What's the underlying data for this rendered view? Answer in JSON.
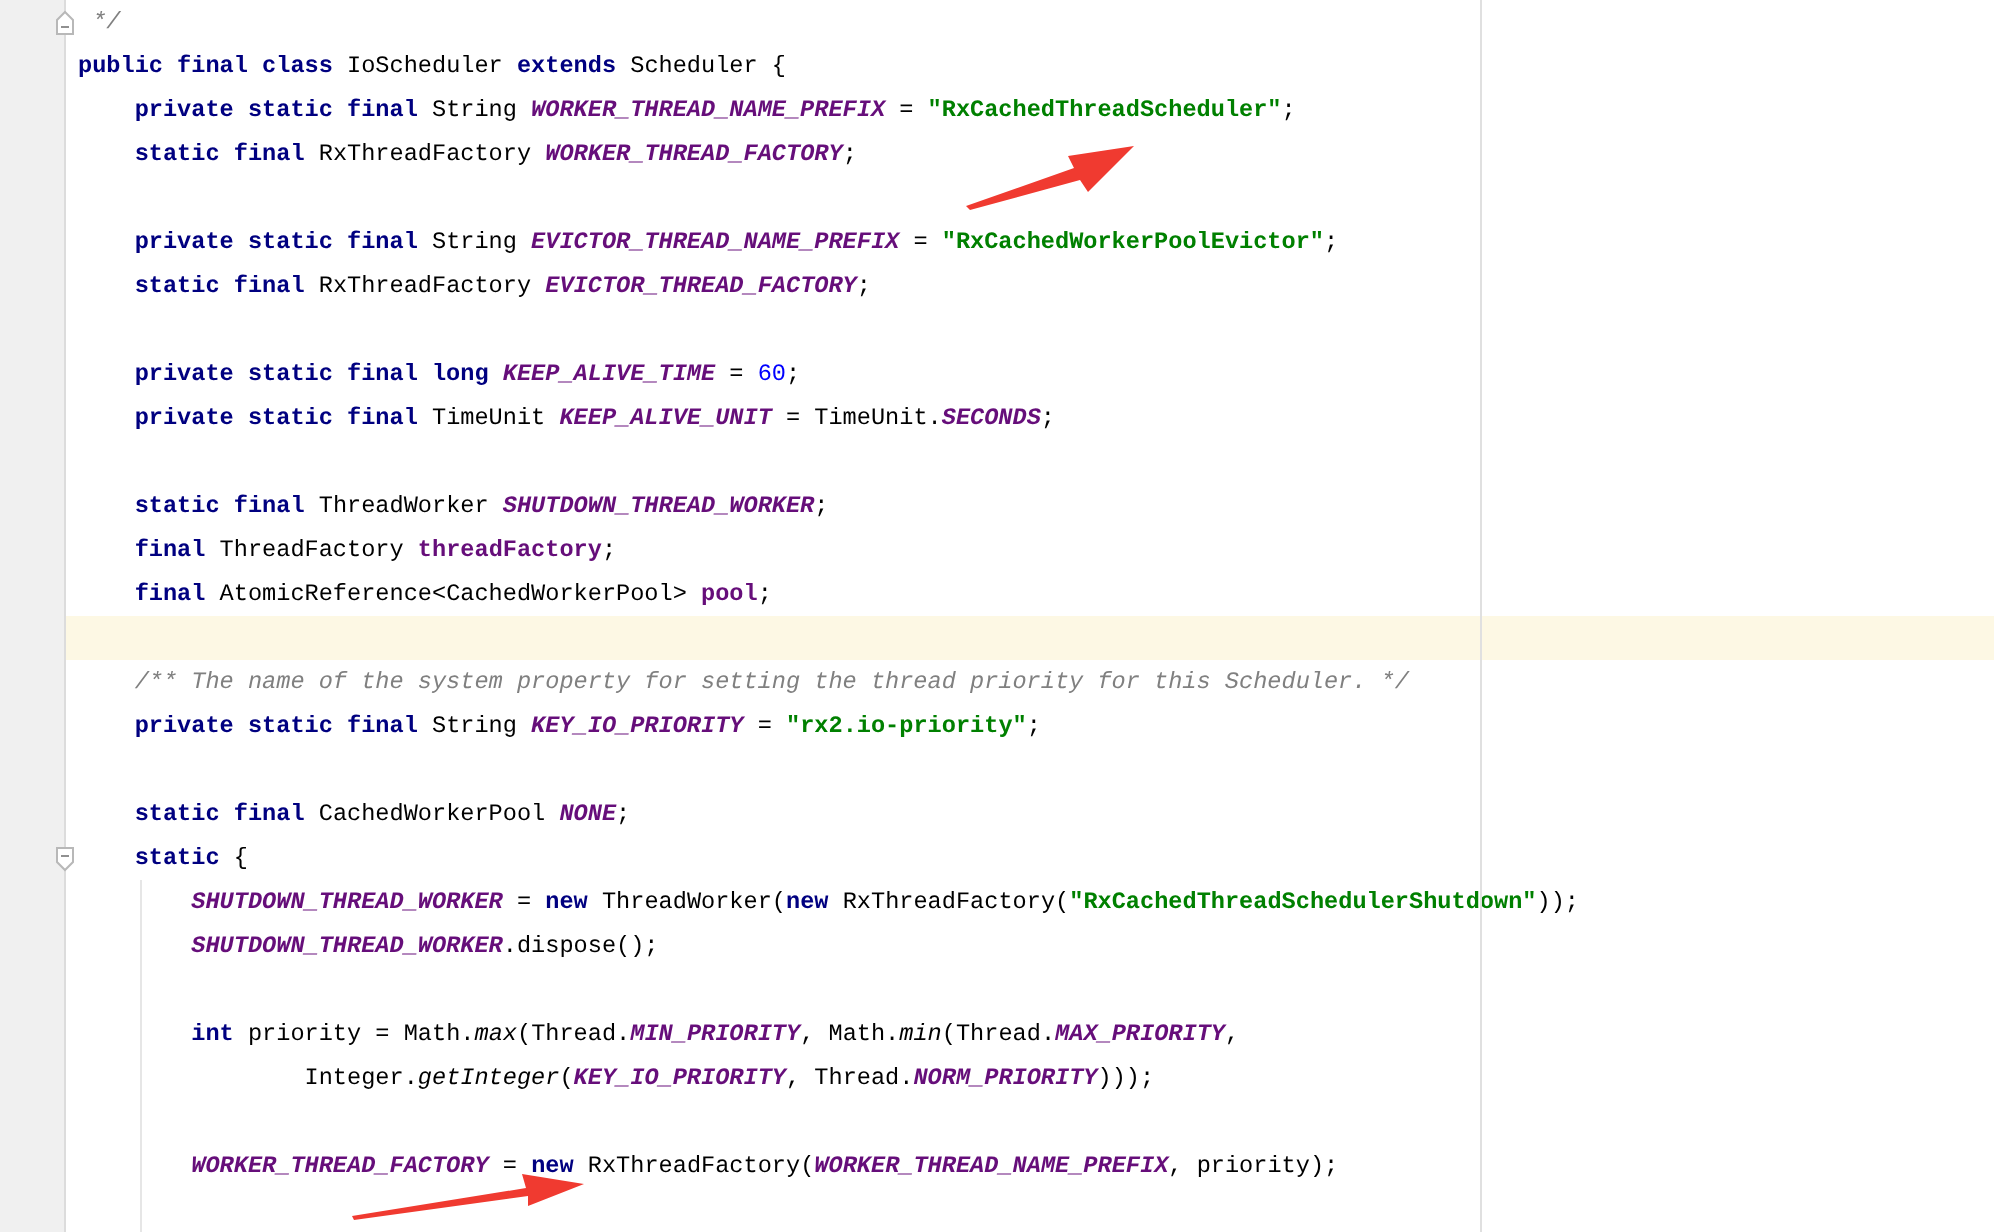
{
  "editor": {
    "lines": [
      {
        "current": false,
        "fold_end": true,
        "tokens": [
          {
            "kind": "comment",
            "text": " */"
          }
        ]
      },
      {
        "current": false,
        "tokens": [
          {
            "kind": "keyword",
            "text": "public final class "
          },
          {
            "kind": "plain",
            "text": "IoScheduler "
          },
          {
            "kind": "keyword",
            "text": "extends "
          },
          {
            "kind": "plain",
            "text": "Scheduler {"
          }
        ]
      },
      {
        "current": false,
        "tokens": [
          {
            "kind": "keyword",
            "text": "    private static final "
          },
          {
            "kind": "plain",
            "text": "String "
          },
          {
            "kind": "constant",
            "text": "WORKER_THREAD_NAME_PREFIX"
          },
          {
            "kind": "plain",
            "text": " = "
          },
          {
            "kind": "string",
            "text": "\"RxCachedThreadScheduler\""
          },
          {
            "kind": "plain",
            "text": ";"
          }
        ]
      },
      {
        "current": false,
        "tokens": [
          {
            "kind": "keyword",
            "text": "    static final "
          },
          {
            "kind": "plain",
            "text": "RxThreadFactory "
          },
          {
            "kind": "constant",
            "text": "WORKER_THREAD_FACTORY"
          },
          {
            "kind": "plain",
            "text": ";"
          }
        ]
      },
      {
        "current": false
      },
      {
        "current": false,
        "tokens": [
          {
            "kind": "keyword",
            "text": "    private static final "
          },
          {
            "kind": "plain",
            "text": "String "
          },
          {
            "kind": "constant",
            "text": "EVICTOR_THREAD_NAME_PREFIX"
          },
          {
            "kind": "plain",
            "text": " = "
          },
          {
            "kind": "string",
            "text": "\"RxCachedWorkerPoolEvictor\""
          },
          {
            "kind": "plain",
            "text": ";"
          }
        ]
      },
      {
        "current": false,
        "tokens": [
          {
            "kind": "keyword",
            "text": "    static final "
          },
          {
            "kind": "plain",
            "text": "RxThreadFactory "
          },
          {
            "kind": "constant",
            "text": "EVICTOR_THREAD_FACTORY"
          },
          {
            "kind": "plain",
            "text": ";"
          }
        ]
      },
      {
        "current": false
      },
      {
        "current": false,
        "tokens": [
          {
            "kind": "keyword",
            "text": "    private static final long "
          },
          {
            "kind": "constant",
            "text": "KEEP_ALIVE_TIME"
          },
          {
            "kind": "plain",
            "text": " = "
          },
          {
            "kind": "number",
            "text": "60"
          },
          {
            "kind": "plain",
            "text": ";"
          }
        ]
      },
      {
        "current": false,
        "tokens": [
          {
            "kind": "keyword",
            "text": "    private static final "
          },
          {
            "kind": "plain",
            "text": "TimeUnit "
          },
          {
            "kind": "constant",
            "text": "KEEP_ALIVE_UNIT"
          },
          {
            "kind": "plain",
            "text": " = TimeUnit."
          },
          {
            "kind": "constant",
            "text": "SECONDS"
          },
          {
            "kind": "plain",
            "text": ";"
          }
        ]
      },
      {
        "current": false
      },
      {
        "current": false,
        "tokens": [
          {
            "kind": "keyword",
            "text": "    static final "
          },
          {
            "kind": "plain",
            "text": "ThreadWorker "
          },
          {
            "kind": "constant",
            "text": "SHUTDOWN_THREAD_WORKER"
          },
          {
            "kind": "plain",
            "text": ";"
          }
        ]
      },
      {
        "current": false,
        "tokens": [
          {
            "kind": "keyword",
            "text": "    final "
          },
          {
            "kind": "plain",
            "text": "ThreadFactory "
          },
          {
            "kind": "field",
            "text": "threadFactory"
          },
          {
            "kind": "plain",
            "text": ";"
          }
        ]
      },
      {
        "current": false,
        "tokens": [
          {
            "kind": "keyword",
            "text": "    final "
          },
          {
            "kind": "plain",
            "text": "AtomicReference<CachedWorkerPool> "
          },
          {
            "kind": "field",
            "text": "pool"
          },
          {
            "kind": "plain",
            "text": ";"
          }
        ]
      },
      {
        "current": true
      },
      {
        "current": false,
        "tokens": [
          {
            "kind": "comment",
            "text": "    /** The name of the system property for setting the thread priority for this Scheduler. */"
          }
        ]
      },
      {
        "current": false,
        "tokens": [
          {
            "kind": "keyword",
            "text": "    private static final "
          },
          {
            "kind": "plain",
            "text": "String "
          },
          {
            "kind": "constant",
            "text": "KEY_IO_PRIORITY"
          },
          {
            "kind": "plain",
            "text": " = "
          },
          {
            "kind": "string",
            "text": "\"rx2.io-priority\""
          },
          {
            "kind": "plain",
            "text": ";"
          }
        ]
      },
      {
        "current": false
      },
      {
        "current": false,
        "tokens": [
          {
            "kind": "keyword",
            "text": "    static final "
          },
          {
            "kind": "plain",
            "text": "CachedWorkerPool "
          },
          {
            "kind": "constant",
            "text": "NONE"
          },
          {
            "kind": "plain",
            "text": ";"
          }
        ]
      },
      {
        "current": false,
        "fold_start": true,
        "tokens": [
          {
            "kind": "keyword",
            "text": "    static "
          },
          {
            "kind": "plain",
            "text": "{"
          }
        ]
      },
      {
        "current": false,
        "tokens": [
          {
            "kind": "constant",
            "text": "        SHUTDOWN_THREAD_WORKER"
          },
          {
            "kind": "plain",
            "text": " = "
          },
          {
            "kind": "keyword",
            "text": "new "
          },
          {
            "kind": "plain",
            "text": "ThreadWorker("
          },
          {
            "kind": "keyword",
            "text": "new "
          },
          {
            "kind": "plain",
            "text": "RxThreadFactory("
          },
          {
            "kind": "string",
            "text": "\"RxCachedThreadSchedulerShutdown\""
          },
          {
            "kind": "plain",
            "text": "));"
          }
        ]
      },
      {
        "current": false,
        "tokens": [
          {
            "kind": "constant",
            "text": "        SHUTDOWN_THREAD_WORKER"
          },
          {
            "kind": "plain",
            "text": ".dispose();"
          }
        ]
      },
      {
        "current": false
      },
      {
        "current": false,
        "tokens": [
          {
            "kind": "keyword",
            "text": "        int "
          },
          {
            "kind": "plain",
            "text": "priority = Math."
          },
          {
            "kind": "static-call",
            "text": "max"
          },
          {
            "kind": "plain",
            "text": "(Thread."
          },
          {
            "kind": "constant",
            "text": "MIN_PRIORITY"
          },
          {
            "kind": "plain",
            "text": ", Math."
          },
          {
            "kind": "static-call",
            "text": "min"
          },
          {
            "kind": "plain",
            "text": "(Thread."
          },
          {
            "kind": "constant",
            "text": "MAX_PRIORITY"
          },
          {
            "kind": "plain",
            "text": ","
          }
        ]
      },
      {
        "current": false,
        "tokens": [
          {
            "kind": "plain",
            "text": "                Integer."
          },
          {
            "kind": "static-call",
            "text": "getInteger"
          },
          {
            "kind": "plain",
            "text": "("
          },
          {
            "kind": "constant",
            "text": "KEY_IO_PRIORITY"
          },
          {
            "kind": "plain",
            "text": ", Thread."
          },
          {
            "kind": "constant",
            "text": "NORM_PRIORITY"
          },
          {
            "kind": "plain",
            "text": ")));"
          }
        ]
      },
      {
        "current": false
      },
      {
        "current": false,
        "tokens": [
          {
            "kind": "constant",
            "text": "        WORKER_THREAD_FACTORY"
          },
          {
            "kind": "plain",
            "text": " = "
          },
          {
            "kind": "keyword",
            "text": "new "
          },
          {
            "kind": "plain",
            "text": "RxThreadFactory("
          },
          {
            "kind": "constant",
            "text": "WORKER_THREAD_NAME_PREFIX"
          },
          {
            "kind": "plain",
            "text": ", priority);"
          }
        ]
      },
      {
        "current": false
      }
    ]
  }
}
